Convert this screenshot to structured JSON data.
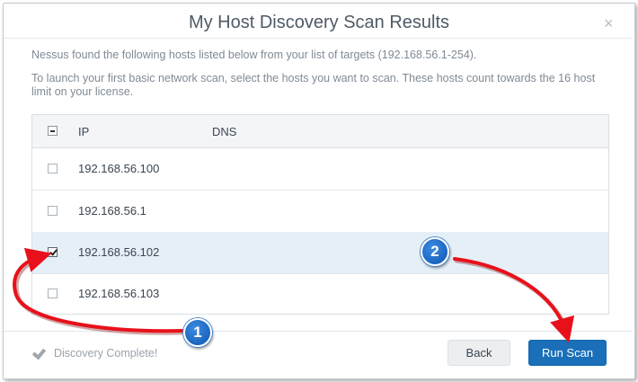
{
  "dialog": {
    "title": "My Host Discovery Scan Results",
    "close_glyph": "×",
    "intro": "Nessus found the following hosts listed below from your list of targets (192.168.56.1-254).",
    "instructions": "To launch your first basic network scan, select the hosts you want to scan. These hosts count towards the 16 host limit on your license."
  },
  "table": {
    "columns": [
      "IP",
      "DNS"
    ],
    "header_checkbox_state": "indeterminate",
    "rows": [
      {
        "ip": "192.168.56.100",
        "dns": "",
        "checked": false
      },
      {
        "ip": "192.168.56.1",
        "dns": "",
        "checked": false
      },
      {
        "ip": "192.168.56.102",
        "dns": "",
        "checked": true
      },
      {
        "ip": "192.168.56.103",
        "dns": "",
        "checked": false
      }
    ]
  },
  "footer": {
    "status": "Discovery Complete!",
    "back_label": "Back",
    "run_label": "Run Scan"
  },
  "annotations": {
    "badge1": "1",
    "badge2": "2",
    "arrow_color": "#e8111b"
  },
  "colors": {
    "accent": "#1a6fb8",
    "selected_row": "#e5eff7"
  }
}
